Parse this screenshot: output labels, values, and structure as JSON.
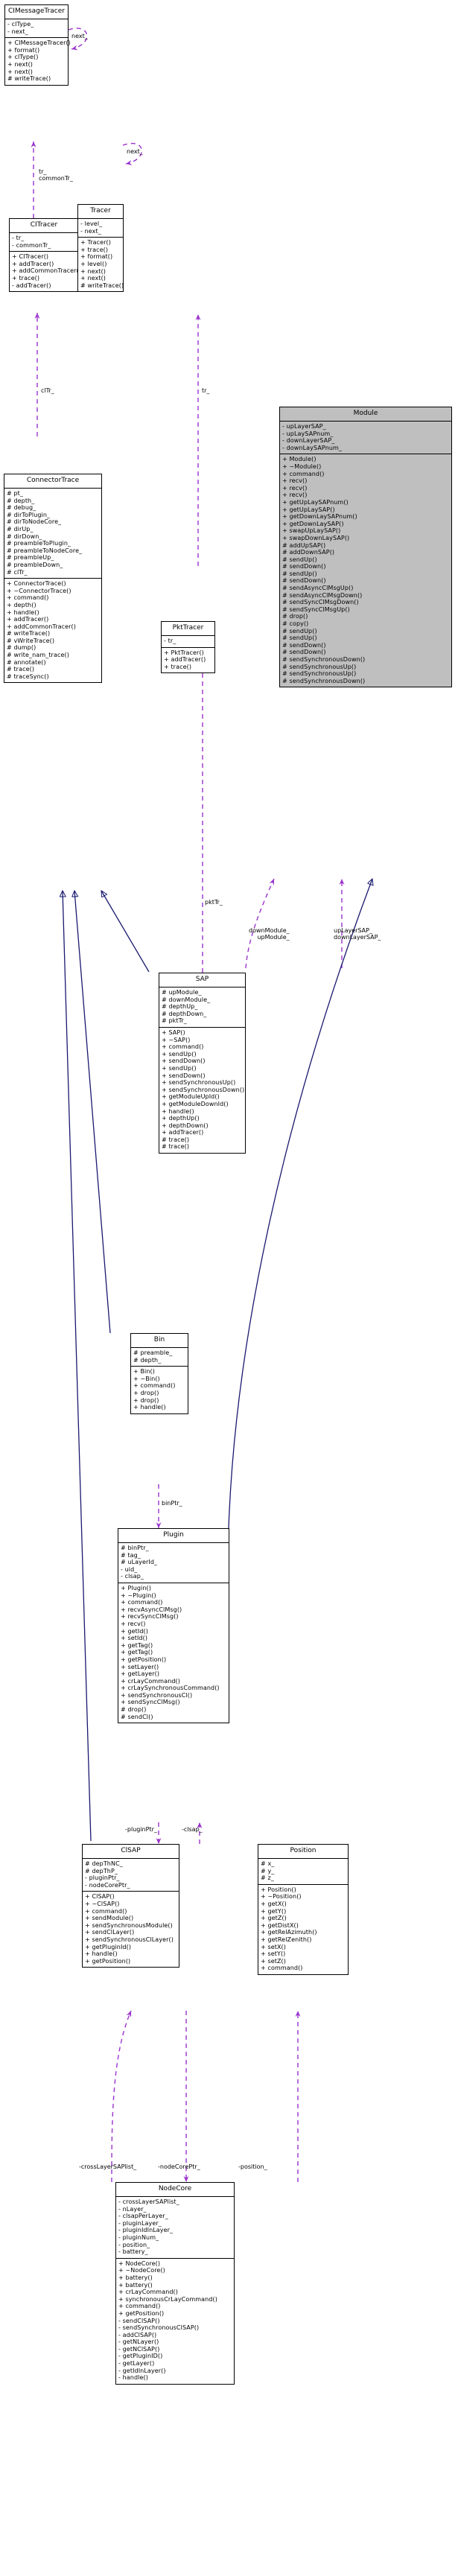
{
  "diagram": {
    "kind": "uml-collaboration-diagram",
    "colors": {
      "inherit_edge": "#191970",
      "usage_edge": "#9a32cd",
      "highlight_fill": "#bfbfbf",
      "box_fill": "#ffffff",
      "border": "#000000"
    }
  },
  "classes": {
    "cimessagetracer": {
      "name": "CIMessageTracer",
      "attrs": [
        "- clType_",
        "- next_"
      ],
      "ops": [
        "+ CIMessageTracer()",
        "+ format()",
        "+ clType()",
        "+ next()",
        "+ next()",
        "# writeTrace()"
      ]
    },
    "citracer": {
      "name": "CITracer",
      "attrs": [
        "- tr_",
        "- commonTr_"
      ],
      "ops": [
        "+ CITracer()",
        "+ addTracer()",
        "+ addCommonTracer()",
        "+ trace()",
        "- addTracer()"
      ]
    },
    "tracer": {
      "name": "Tracer",
      "attrs": [
        "- level_",
        "- next_"
      ],
      "ops": [
        "+ Tracer()",
        "+ trace()",
        "+ format()",
        "+ level()",
        "+ next()",
        "+ next()",
        "# writeTrace()"
      ]
    },
    "module": {
      "name": "Module",
      "attrs": [
        "- upLayerSAP_",
        "- upLaySAPnum_",
        "- downLayerSAP_",
        "- downLaySAPnum_"
      ],
      "ops": [
        "+ Module()",
        "+ ~Module()",
        "+ command()",
        "+ recv()",
        "+ recv()",
        "+ recv()",
        "+ getUpLaySAPnum()",
        "+ getUpLaySAP()",
        "+ getDownLaySAPnum()",
        "+ getDownLaySAP()",
        "+ swapUpLaySAP()",
        "+ swapDownLaySAP()",
        "# addUpSAP()",
        "# addDownSAP()",
        "# sendUp()",
        "# sendDown()",
        "# sendUp()",
        "# sendDown()",
        "# sendAsyncClMsgUp()",
        "# sendAsyncClMsgDown()",
        "# sendSyncClMsgDown()",
        "# sendSyncClMsgUp()",
        "# drop()",
        "# copy()",
        "# sendUp()",
        "# sendUp()",
        "# sendDown()",
        "# sendDown()",
        "# sendSynchronousDown()",
        "# sendSynchronousUp()",
        "# sendSynchronousUp()",
        "# sendSynchronousDown()"
      ]
    },
    "connectortrace": {
      "name": "ConnectorTrace",
      "attrs": [
        "# pt_",
        "# depth_",
        "# debug_",
        "# dirToPlugin_",
        "# dirToNodeCore_",
        "# dirUp_",
        "# dirDown_",
        "# preambleToPlugin_",
        "# preambleToNodeCore_",
        "# preambleUp_",
        "# preambleDown_",
        "# clTr_"
      ],
      "ops": [
        "+ ConnectorTrace()",
        "+ ~ConnectorTrace()",
        "+ command()",
        "+ depth()",
        "+ handle()",
        "+ addTracer()",
        "+ addCommonTracer()",
        "# writeTrace()",
        "# vWriteTrace()",
        "# dump()",
        "# write_nam_trace()",
        "# annotate()",
        "# trace()",
        "# traceSync()"
      ]
    },
    "pkttracer": {
      "name": "PktTracer",
      "attrs": [
        "- tr_"
      ],
      "ops": [
        "+ PktTracer()",
        "+ addTracer()",
        "+ trace()"
      ]
    },
    "sap": {
      "name": "SAP",
      "attrs": [
        "# upModule_",
        "# downModule_",
        "# depthUp_",
        "# depthDown_",
        "# pktTr_"
      ],
      "ops": [
        "+ SAP()",
        "+ ~SAP()",
        "+ command()",
        "+ sendUp()",
        "+ sendDown()",
        "+ sendUp()",
        "+ sendDown()",
        "+ sendSynchronousUp()",
        "+ sendSynchronousDown()",
        "+ getModuleUpId()",
        "+ getModuleDownId()",
        "+ handle()",
        "+ depthUp()",
        "+ depthDown()",
        "+ addTracer()",
        "# trace()",
        "# trace()"
      ]
    },
    "bin": {
      "name": "Bin",
      "attrs": [
        "# preamble_",
        "# depth_"
      ],
      "ops": [
        "+ Bin()",
        "+ ~Bin()",
        "+ command()",
        "+ drop()",
        "+ drop()",
        "+ handle()"
      ]
    },
    "plugin": {
      "name": "Plugin",
      "attrs": [
        "# binPtr_",
        "# tag_",
        "# uLayerId_",
        "- uid_",
        "- clsap_"
      ],
      "ops": [
        "+ Plugin()",
        "+ ~Plugin()",
        "+ command()",
        "+ recvAsyncClMsg()",
        "+ recvSyncClMsg()",
        "+ recv()",
        "+ getId()",
        "+ setId()",
        "+ getTag()",
        "+ getTag()",
        "+ getPosition()",
        "+ setLayer()",
        "+ getLayer()",
        "+ crLayCommand()",
        "+ crLaySynchronousCommand()",
        "+ sendSynchronousCl()",
        "+ sendSyncClMsg()",
        "# drop()",
        "# sendCl()"
      ]
    },
    "clsap": {
      "name": "ClSAP",
      "attrs": [
        "# depThNC_",
        "# depThP_",
        "- pluginPtr_",
        "- nodeCorePtr_"
      ],
      "ops": [
        "+ ClSAP()",
        "+ ~ClSAP()",
        "+ command()",
        "+ sendModule()",
        "+ sendSynchronousModule()",
        "+ sendClLayer()",
        "+ sendSynchronousClLayer()",
        "+ getPluginId()",
        "+ handle()",
        "+ getPosition()"
      ]
    },
    "position": {
      "name": "Position",
      "attrs": [
        "# x_",
        "# y_",
        "# z_"
      ],
      "ops": [
        "+ Position()",
        "+ ~Position()",
        "+ getX()",
        "+ getY()",
        "+ getZ()",
        "+ getDistX()",
        "+ getRelAzimuth()",
        "+ getRelZenith()",
        "+ setX()",
        "+ setY()",
        "+ setZ()",
        "+ command()"
      ]
    },
    "nodecore": {
      "name": "NodeCore",
      "attrs": [
        "- crossLayerSAPlist_",
        "- nLayer_",
        "- clsapPerLayer_",
        "- pluginLayer_",
        "- pluginIdInLayer_",
        "- pluginNum_",
        "- position_",
        "- battery_"
      ],
      "ops": [
        "+ NodeCore()",
        "+ ~NodeCore()",
        "+ battery()",
        "+ battery()",
        "+ crLayCommand()",
        "+ synchronousCrLayCommand()",
        "+ command()",
        "+ getPosition()",
        "- sendClSAP()",
        "- sendSynchronousClSAP()",
        "- addClSAP()",
        "- getNLayer()",
        "- getNClSAP()",
        "- getPluginID()",
        "- getLayer()",
        "- getIdInLayer()",
        "- handle()"
      ]
    }
  },
  "edge_labels": {
    "next_top": "next_",
    "tr_commontr": "tr_\ncommonTr_",
    "cltr": "clTr_",
    "tr_right": "tr_",
    "next_tracer": "next_",
    "pkttr": "pktTr_",
    "downmodule_upmodule": "downModule_\nupModule_",
    "uplayersap_downlayersap": "upLayerSAP_\ndownLayerSAP_",
    "binptr": "binPtr_",
    "pluginptr": "-pluginPtr_",
    "clsap": "-clsap_",
    "crosslayersaplist": "-crossLayerSAPlist_",
    "nodecoreptr": "-nodeCorePtr_",
    "position": "-position_"
  }
}
